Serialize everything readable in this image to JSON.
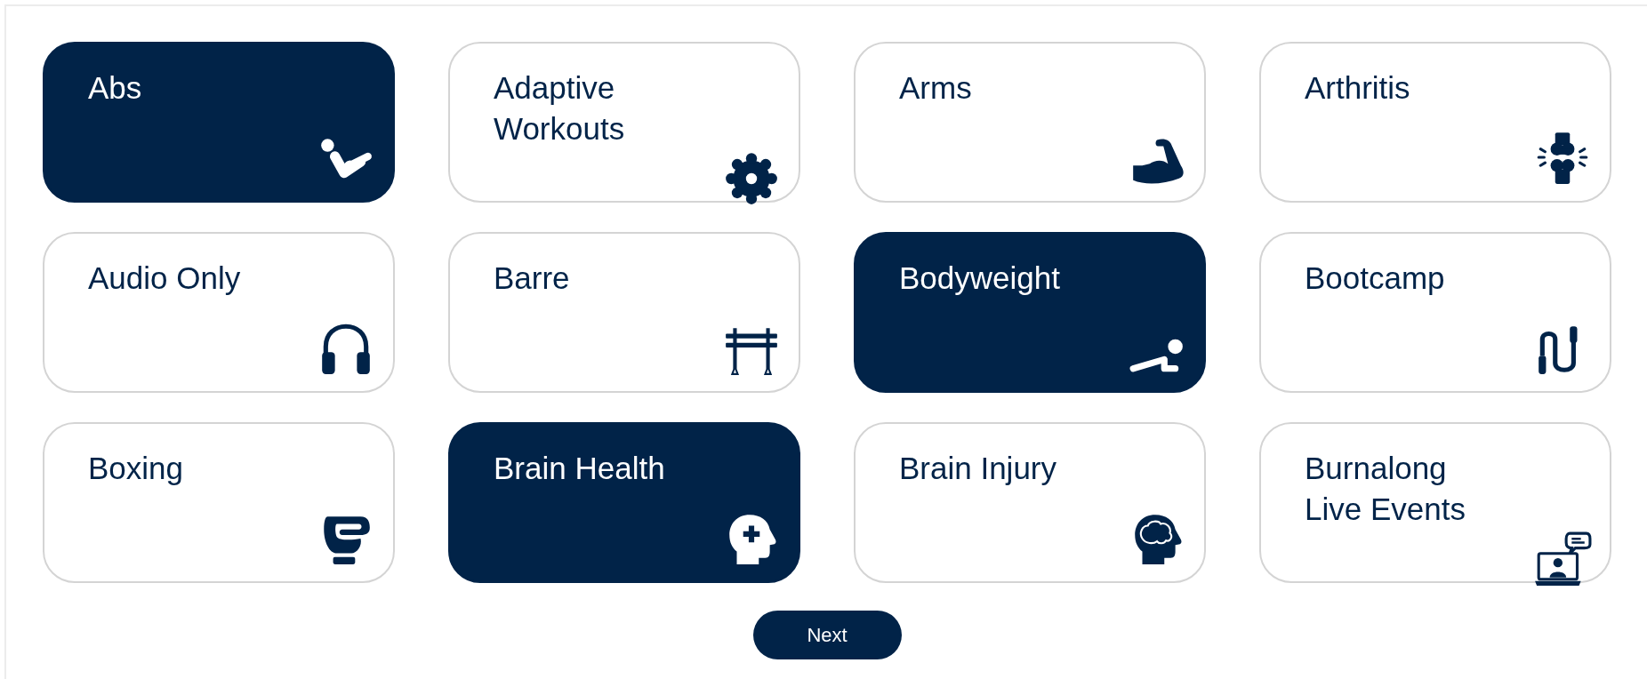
{
  "categories": [
    {
      "label": "Abs",
      "selected": true
    },
    {
      "label": "Adaptive Workouts",
      "selected": false
    },
    {
      "label": "Arms",
      "selected": false
    },
    {
      "label": "Arthritis",
      "selected": false
    },
    {
      "label": "Audio Only",
      "selected": false
    },
    {
      "label": "Barre",
      "selected": false
    },
    {
      "label": "Bodyweight",
      "selected": true
    },
    {
      "label": "Bootcamp",
      "selected": false
    },
    {
      "label": "Boxing",
      "selected": false
    },
    {
      "label": "Brain Health",
      "selected": true
    },
    {
      "label": "Brain Injury",
      "selected": false
    },
    {
      "label": "Burnalong Live Events",
      "selected": false
    }
  ],
  "next_button": "Next"
}
